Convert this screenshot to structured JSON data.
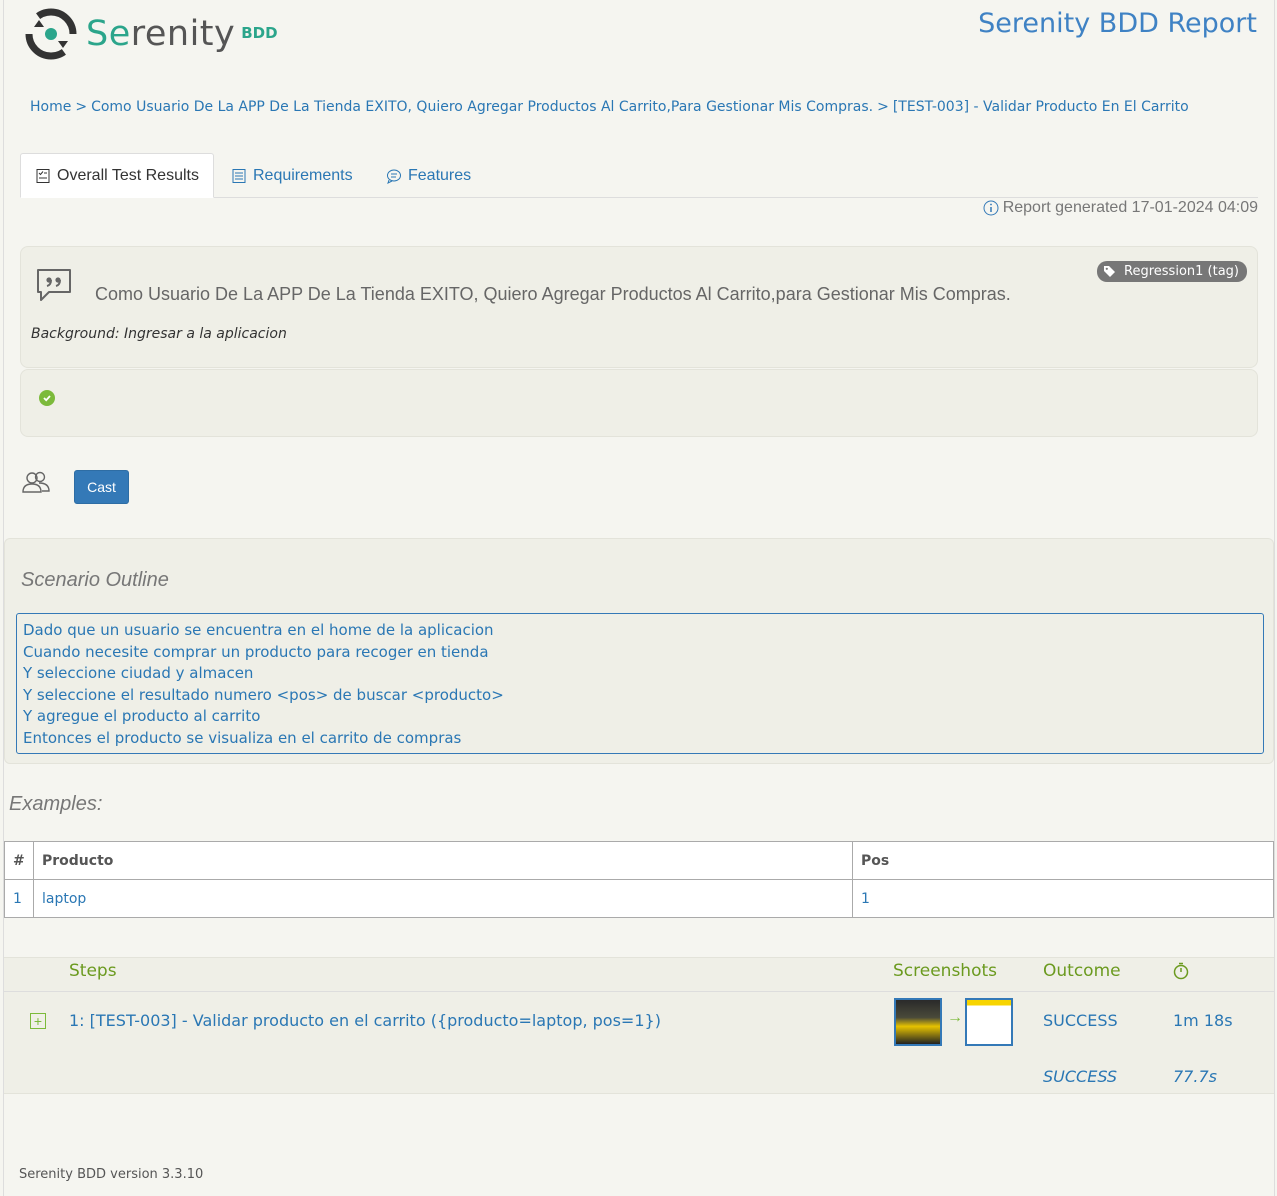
{
  "header": {
    "logo_text_accent": "Se",
    "logo_text_rest": "renity",
    "logo_sub": "BDD",
    "report_title": "Serenity BDD Report"
  },
  "breadcrumb": {
    "home": "Home",
    "feature": "Como Usuario De La APP De La Tienda EXITO, Quiero Agregar Productos Al Carrito,Para Gestionar Mis Compras.",
    "scenario": "[TEST-003] - Validar Producto En El Carrito",
    "separator": ">"
  },
  "tabs": [
    {
      "label": "Overall Test Results",
      "icon": "checklist-icon",
      "active": true
    },
    {
      "label": "Requirements",
      "icon": "list-icon",
      "active": false
    },
    {
      "label": "Features",
      "icon": "comment-icon",
      "active": false
    }
  ],
  "report_generated": "Report generated 17-01-2024 04:09",
  "feature": {
    "title": "Como Usuario De La APP De La Tienda EXITO, Quiero Agregar Productos Al Carrito,para Gestionar Mis Compras.",
    "tag": "Regression1 (tag)",
    "background_label": "Background:",
    "background_text": "Ingresar a la aplicacion",
    "status_color": "#7cba3b"
  },
  "cast": {
    "button_label": "Cast"
  },
  "scenario_outline": {
    "title": "Scenario Outline",
    "lines": [
      "Dado que un usuario se encuentra en el home de la aplicacion",
      "Cuando necesite comprar un producto para recoger en tienda",
      "Y seleccione ciudad y almacen",
      "Y seleccione el resultado numero <pos> de buscar <producto>",
      "Y agregue el producto al carrito",
      "Entonces el producto se visualiza en el carrito de compras"
    ]
  },
  "examples": {
    "title": "Examples:",
    "headers": [
      "#",
      "Producto",
      "Pos"
    ],
    "rows": [
      [
        "1",
        "laptop",
        "1"
      ]
    ]
  },
  "steps": {
    "headers": {
      "steps": "Steps",
      "screenshots": "Screenshots",
      "outcome": "Outcome",
      "duration_icon": "stopwatch-icon"
    },
    "rows": [
      {
        "label": "1: [TEST-003] - Validar producto en el carrito ({producto=laptop, pos=1})",
        "outcome": "SUCCESS",
        "duration": "1m 18s"
      }
    ],
    "summary": {
      "outcome": "SUCCESS",
      "duration": "77.7s"
    }
  },
  "footer": "Serenity BDD version 3.3.10",
  "colors": {
    "accent": "#2ba58b",
    "link": "#2a77b4",
    "success": "#7cba3b",
    "button": "#3479b7"
  }
}
